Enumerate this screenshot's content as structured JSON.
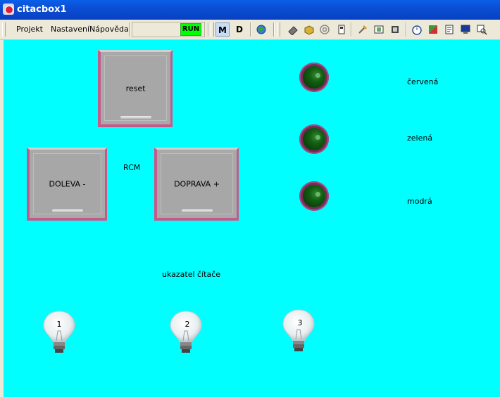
{
  "window": {
    "title": "citacbox1"
  },
  "menu": {
    "items": [
      "Projekt",
      "Nastavení",
      "Nápověda"
    ]
  },
  "toolbar": {
    "run_label": "RUN",
    "mode_m": "M",
    "mode_d": "D"
  },
  "canvas": {
    "background": "#00ffff",
    "buttons": {
      "reset": "reset",
      "left": "DOLEVA -",
      "right": "DOPRAVA +"
    },
    "rcm_label": "RCM",
    "counter_label": "ukazatel čítače",
    "leds": [
      {
        "label": "červená",
        "state": "off"
      },
      {
        "label": "zelená",
        "state": "off"
      },
      {
        "label": "modrá",
        "state": "off"
      }
    ],
    "bulbs": [
      "1",
      "2",
      "3"
    ]
  },
  "colors": {
    "run": "#00ff00",
    "canvas": "#00ffff",
    "button_border": "#c55a8a",
    "led_off": "#116011"
  }
}
